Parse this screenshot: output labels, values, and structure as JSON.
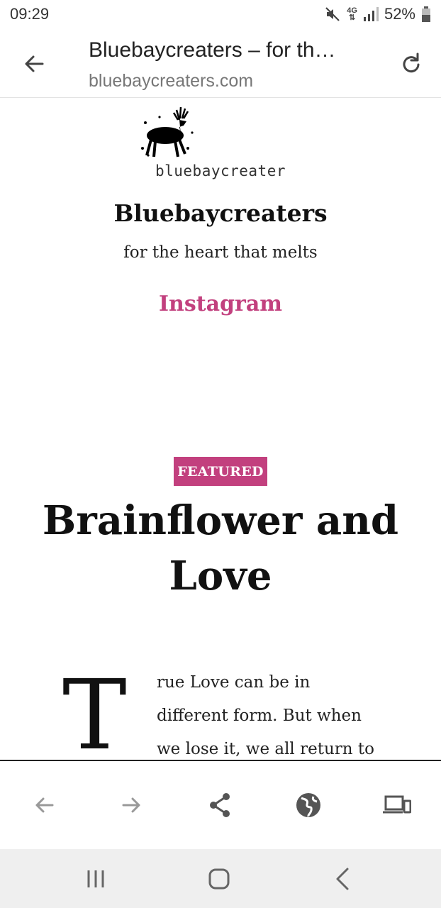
{
  "status_bar": {
    "time": "09:29",
    "network": "4G",
    "battery": "52%",
    "icons": [
      "mute-icon",
      "network-4g-icon",
      "signal-icon",
      "battery-icon"
    ]
  },
  "browser": {
    "page_title": "Bluebaycreaters – for th…",
    "url": "bluebaycreaters.com",
    "icons": [
      "back-arrow-icon",
      "reload-icon"
    ]
  },
  "site": {
    "logo_text": "bluebaycreater",
    "title": "Bluebaycreaters",
    "tagline": "for the heart that melts",
    "nav": [
      "Instagram"
    ]
  },
  "post": {
    "badge": "FEATURED",
    "title": "Brainflower and Love",
    "dropcap": "T",
    "excerpt_lines": [
      "rue Love can be in",
      "different form. But when",
      "we lose it, we all return to"
    ]
  },
  "toolbar": {
    "icons": [
      "back-icon",
      "forward-icon",
      "share-icon",
      "globe-icon",
      "devices-icon"
    ]
  },
  "navbar": {
    "icons": [
      "recents-icon",
      "home-icon",
      "nav-back-icon"
    ]
  },
  "colors": {
    "accent": "#c2407e",
    "text": "#111111",
    "nav_bg": "#efefef"
  }
}
